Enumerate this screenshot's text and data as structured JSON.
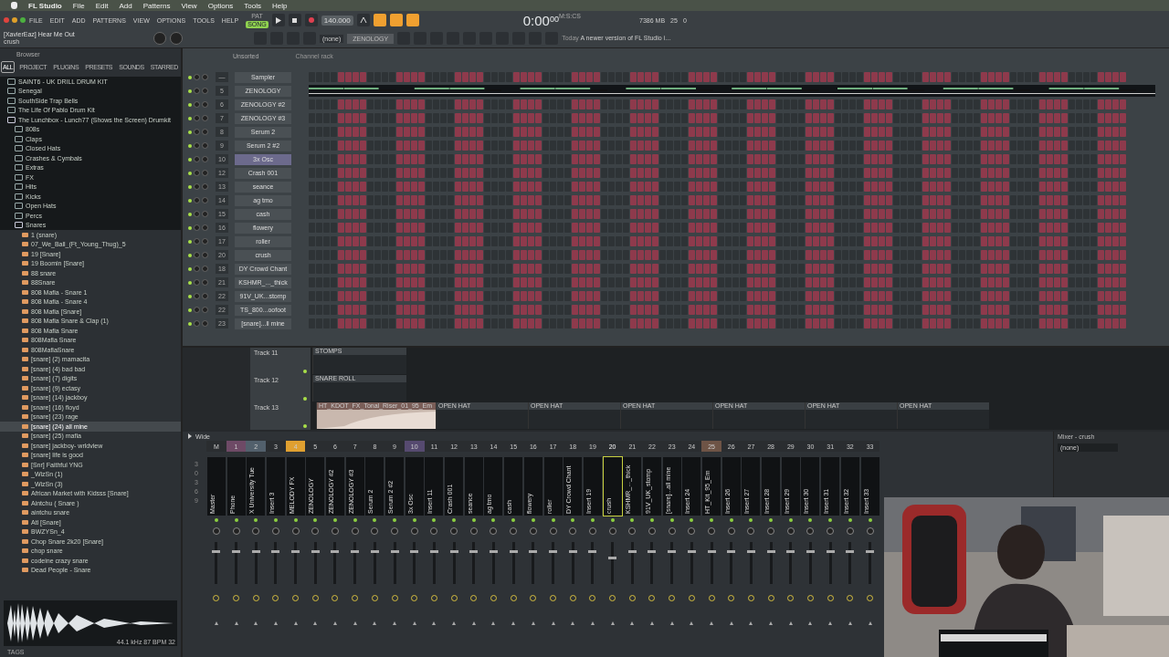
{
  "mac_menu": {
    "app": "FL Studio",
    "items": [
      "File",
      "Edit",
      "Add",
      "Patterns",
      "View",
      "Options",
      "Tools",
      "Help"
    ]
  },
  "toolbar": {
    "menu": [
      "FILE",
      "EDIT",
      "ADD",
      "PATTERNS",
      "VIEW",
      "OPTIONS",
      "TOOLS",
      "HELP"
    ],
    "modes": [
      {
        "label": "PAT",
        "selected": false
      },
      {
        "label": "SONG",
        "selected": true
      }
    ],
    "tempo": "140.000",
    "time": "0:00",
    "time_small": "00",
    "time_unit": "M:S:CS",
    "cpu": "25",
    "memory": "7386 MB",
    "polyphony": "0",
    "hint_title": "[XavierEaz] Hear Me Out",
    "hint_sub": "crush",
    "pattern": "(none)",
    "plugin": "ZENOLOGY",
    "news_date": "Today",
    "news": "A newer version of FL Studio i…"
  },
  "browser": {
    "title": "Browser",
    "tabs": [
      {
        "label": "ALL",
        "selected": true
      },
      {
        "label": "PROJECT",
        "selected": false
      },
      {
        "label": "PLUGINS",
        "selected": false
      },
      {
        "label": "PRESETS",
        "selected": false
      },
      {
        "label": "SOUNDS",
        "selected": false
      },
      {
        "label": "STARRED",
        "selected": false
      }
    ],
    "tree": [
      {
        "name": "SAINT6 - UK DRILL DRUM KIT",
        "kind": "folder",
        "expanded": false,
        "selected": false
      },
      {
        "name": "Senegal",
        "kind": "folder",
        "expanded": false,
        "selected": false
      },
      {
        "name": "SouthSide Trap Bells",
        "kind": "folder",
        "expanded": false,
        "selected": false
      },
      {
        "name": "The Life Of Pablo Drum Kit",
        "kind": "folder",
        "expanded": false,
        "selected": false
      },
      {
        "name": "The Lunchbox - Lunch77 (Shows the Screen) Drumkit",
        "kind": "folder",
        "expanded": true,
        "selected": false,
        "children": [
          {
            "name": "808s",
            "kind": "folder",
            "expanded": false,
            "selected": false
          },
          {
            "name": "Claps",
            "kind": "folder",
            "expanded": false,
            "selected": false
          },
          {
            "name": "Closed Hats",
            "kind": "folder",
            "expanded": false,
            "selected": false
          },
          {
            "name": "Crashes & Cymbals",
            "kind": "folder",
            "expanded": false,
            "selected": false
          },
          {
            "name": "Extras",
            "kind": "folder",
            "expanded": false,
            "selected": false
          },
          {
            "name": "FX",
            "kind": "folder",
            "expanded": false,
            "selected": false
          },
          {
            "name": "Hits",
            "kind": "folder",
            "expanded": false,
            "selected": false
          },
          {
            "name": "Kicks",
            "kind": "folder",
            "expanded": false,
            "selected": false
          },
          {
            "name": "Open Hats",
            "kind": "folder",
            "expanded": false,
            "selected": false
          },
          {
            "name": "Percs",
            "kind": "folder",
            "expanded": false,
            "selected": false
          },
          {
            "name": "Snares",
            "kind": "folder",
            "expanded": true,
            "selected": false,
            "children": [
              {
                "name": "1 (snare)",
                "kind": "file",
                "selected": false
              },
              {
                "name": "07_We_Ball_(Ft_Young_Thug)_5",
                "kind": "file",
                "selected": false
              },
              {
                "name": "19 [Snare]",
                "kind": "file",
                "selected": false
              },
              {
                "name": "19 Boomin [Snare]",
                "kind": "file",
                "selected": false
              },
              {
                "name": "88 snare",
                "kind": "file",
                "selected": false
              },
              {
                "name": "88Snare",
                "kind": "file",
                "selected": false
              },
              {
                "name": "808 Mafia - Snare 1",
                "kind": "file",
                "selected": false
              },
              {
                "name": "808 Mafia - Snare 4",
                "kind": "file",
                "selected": false
              },
              {
                "name": "808 Mafia [Snare]",
                "kind": "file",
                "selected": false
              },
              {
                "name": "808 Mafia Snare & Clap (1)",
                "kind": "file",
                "selected": false
              },
              {
                "name": "808 Mafia Snare",
                "kind": "file",
                "selected": false
              },
              {
                "name": "808Mafia Snare",
                "kind": "file",
                "selected": false
              },
              {
                "name": "808MafiaSnare",
                "kind": "file",
                "selected": false
              },
              {
                "name": "[snare] (2) mamacita",
                "kind": "file",
                "selected": false
              },
              {
                "name": "[snare] (4) bad bad",
                "kind": "file",
                "selected": false
              },
              {
                "name": "[snare] (7) digits",
                "kind": "file",
                "selected": false
              },
              {
                "name": "[snare] (9) ectasy",
                "kind": "file",
                "selected": false
              },
              {
                "name": "[snare] (14)  jackboy",
                "kind": "file",
                "selected": false
              },
              {
                "name": "[snare] (16) floyd",
                "kind": "file",
                "selected": false
              },
              {
                "name": "[snare] (23) rage",
                "kind": "file",
                "selected": false
              },
              {
                "name": "[snare] (24) all mine",
                "kind": "file",
                "selected": true
              },
              {
                "name": "[snare] (25) mafia",
                "kind": "file",
                "selected": false
              },
              {
                "name": "[snare] jackboy- wrldview",
                "kind": "file",
                "selected": false
              },
              {
                "name": "[snare] life is good",
                "kind": "file",
                "selected": false
              },
              {
                "name": "[Snr] Faithful YNG",
                "kind": "file",
                "selected": false
              },
              {
                "name": "_WizSn (1)",
                "kind": "file",
                "selected": false
              },
              {
                "name": "_WizSn (3)",
                "kind": "file",
                "selected": false
              },
              {
                "name": "African Market with Kidsss  [Snare]",
                "kind": "file",
                "selected": false
              },
              {
                "name": "Aintchu ( Snare )",
                "kind": "file",
                "selected": false
              },
              {
                "name": "aintchu snare",
                "kind": "file",
                "selected": false
              },
              {
                "name": "Atl [Snare]",
                "kind": "file",
                "selected": false
              },
              {
                "name": "BWZYSn_4",
                "kind": "file",
                "selected": false
              },
              {
                "name": "Chop Snare 2k20 [Snare]",
                "kind": "file",
                "selected": false
              },
              {
                "name": "chop snare",
                "kind": "file",
                "selected": false
              },
              {
                "name": "codeine crazy snare",
                "kind": "file",
                "selected": false
              },
              {
                "name": "Dead People - Snare",
                "kind": "file",
                "selected": false
              }
            ]
          }
        ]
      }
    ],
    "sample_info": "44.1 kHz 87 BPM 32",
    "tags": "TAGS"
  },
  "channel_rack": {
    "group": "Unsorted",
    "title": "Channel rack",
    "channels": [
      {
        "number": "—",
        "name": "Sampler",
        "kind": "steps",
        "selected": false
      },
      {
        "number": "5",
        "name": "ZENOLOGY",
        "kind": "preview",
        "selected": false
      },
      {
        "number": "6",
        "name": "ZENOLOGY #2",
        "kind": "steps",
        "selected": false
      },
      {
        "number": "7",
        "name": "ZENOLOGY #3",
        "kind": "steps",
        "selected": false
      },
      {
        "number": "8",
        "name": "Serum 2",
        "kind": "steps",
        "selected": false
      },
      {
        "number": "9",
        "name": "Serum 2 #2",
        "kind": "steps",
        "selected": false
      },
      {
        "number": "10",
        "name": "3x Osc",
        "kind": "steps",
        "selected": true
      },
      {
        "number": "12",
        "name": "Crash 001",
        "kind": "steps",
        "selected": false
      },
      {
        "number": "13",
        "name": "seance",
        "kind": "steps",
        "selected": false
      },
      {
        "number": "14",
        "name": "ag tmo",
        "kind": "steps",
        "selected": false
      },
      {
        "number": "15",
        "name": "cash",
        "kind": "steps",
        "selected": false
      },
      {
        "number": "16",
        "name": "flowery",
        "kind": "steps",
        "selected": false
      },
      {
        "number": "17",
        "name": "roller",
        "kind": "steps",
        "selected": false
      },
      {
        "number": "20",
        "name": "crush",
        "kind": "steps",
        "selected": false
      },
      {
        "number": "18",
        "name": "DY Crowd Chant",
        "kind": "steps",
        "selected": false
      },
      {
        "number": "21",
        "name": "KSHMR_..._thick",
        "kind": "steps",
        "selected": false
      },
      {
        "number": "22",
        "name": "91V_UK...stomp",
        "kind": "steps",
        "selected": false
      },
      {
        "number": "22",
        "name": "TS_800...oofoot",
        "kind": "steps",
        "selected": false
      },
      {
        "number": "23",
        "name": "[snare]...ll mine",
        "kind": "steps",
        "selected": false
      }
    ]
  },
  "playlist": {
    "tracks": [
      {
        "name": "Track 11",
        "clips": [
          {
            "name": "STOMPS",
            "kind": "pattern"
          }
        ]
      },
      {
        "name": "Track 12",
        "clips": [
          {
            "name": "SNARE ROLL",
            "kind": "pattern"
          }
        ]
      },
      {
        "name": "Track 13",
        "clips": [
          {
            "name": "HT_KDOT_FX_Tonal_Riser_01_95_Em",
            "kind": "audio"
          },
          {
            "name": "OPEN HAT",
            "kind": "pattern"
          },
          {
            "name": "OPEN HAT",
            "kind": "pattern"
          },
          {
            "name": "OPEN HAT",
            "kind": "pattern"
          },
          {
            "name": "OPEN HAT",
            "kind": "pattern"
          },
          {
            "name": "OPEN HAT",
            "kind": "pattern"
          },
          {
            "name": "OPEN HAT",
            "kind": "pattern"
          }
        ]
      }
    ]
  },
  "mixer": {
    "title": "Wide",
    "scale": [
      "3",
      "0",
      "3",
      "6",
      "9"
    ],
    "panel_title": "Mixer - crush",
    "slot": "(none)",
    "inserts": [
      {
        "number": "M",
        "name": "Master",
        "color": "#2a2d30",
        "selected": false,
        "level": 0.8
      },
      {
        "number": "1",
        "name": "Phone",
        "color": "#6e4a66",
        "selected": false,
        "level": 0.8
      },
      {
        "number": "2",
        "name": "X University Tue",
        "color": "#52606c",
        "selected": false,
        "level": 0.8
      },
      {
        "number": "3",
        "name": "Insert 3",
        "color": "#2a2d30",
        "selected": false,
        "level": 0.8
      },
      {
        "number": "4",
        "name": "MELODY FX",
        "color": "#e0a030",
        "selected": false,
        "level": 0.8
      },
      {
        "number": "5",
        "name": "ZENOLOGY",
        "color": "#2a2d30",
        "selected": false,
        "level": 0.8
      },
      {
        "number": "6",
        "name": "ZENOLOGY #2",
        "color": "#2a2d30",
        "selected": false,
        "level": 0.8
      },
      {
        "number": "7",
        "name": "ZENOLOGY #3",
        "color": "#2a2d30",
        "selected": false,
        "level": 0.8
      },
      {
        "number": "8",
        "name": "Serum 2",
        "color": "#2a2d30",
        "selected": false,
        "level": 0.8
      },
      {
        "number": "9",
        "name": "Serum 2 #2",
        "color": "#2a2d30",
        "selected": false,
        "level": 0.8
      },
      {
        "number": "10",
        "name": "3x Osc",
        "color": "#564a70",
        "selected": false,
        "level": 0.8
      },
      {
        "number": "11",
        "name": "Insert 11",
        "color": "#2a2d30",
        "selected": false,
        "level": 0.8
      },
      {
        "number": "12",
        "name": "Crash 001",
        "color": "#2a2d30",
        "selected": false,
        "level": 0.8
      },
      {
        "number": "13",
        "name": "seance",
        "color": "#2a2d30",
        "selected": false,
        "level": 0.8
      },
      {
        "number": "14",
        "name": "ag tmo",
        "color": "#2a2d30",
        "selected": false,
        "level": 0.8
      },
      {
        "number": "15",
        "name": "cash",
        "color": "#2a2d30",
        "selected": false,
        "level": 0.8
      },
      {
        "number": "16",
        "name": "flowery",
        "color": "#2a2d30",
        "selected": false,
        "level": 0.8
      },
      {
        "number": "17",
        "name": "roller",
        "color": "#2a2d30",
        "selected": false,
        "level": 0.8
      },
      {
        "number": "18",
        "name": "DY Crowd Chant",
        "color": "#2a2d30",
        "selected": false,
        "level": 0.8
      },
      {
        "number": "19",
        "name": "Insert 19",
        "color": "#2a2d30",
        "selected": false,
        "level": 0.8
      },
      {
        "number": "20",
        "name": "crush",
        "color": "#2a2d30",
        "selected": true,
        "level": 0.62
      },
      {
        "number": "21",
        "name": "KSHMR_..._thick",
        "color": "#2a2d30",
        "selected": false,
        "level": 0.8
      },
      {
        "number": "22",
        "name": "91V_UK_stomp",
        "color": "#2a2d30",
        "selected": false,
        "level": 0.8
      },
      {
        "number": "23",
        "name": "[snare]...all mine",
        "color": "#2a2d30",
        "selected": false,
        "level": 0.8
      },
      {
        "number": "24",
        "name": "Insert 24",
        "color": "#2a2d30",
        "selected": false,
        "level": 0.8
      },
      {
        "number": "25",
        "name": "HT_Kit_95_Em",
        "color": "#6e5446",
        "selected": false,
        "level": 0.8
      },
      {
        "number": "26",
        "name": "Insert 26",
        "color": "#2a2d30",
        "selected": false,
        "level": 0.8
      },
      {
        "number": "27",
        "name": "Insert 27",
        "color": "#2a2d30",
        "selected": false,
        "level": 0.8
      },
      {
        "number": "28",
        "name": "Insert 28",
        "color": "#2a2d30",
        "selected": false,
        "level": 0.8
      },
      {
        "number": "29",
        "name": "Insert 29",
        "color": "#2a2d30",
        "selected": false,
        "level": 0.8
      },
      {
        "number": "30",
        "name": "Insert 30",
        "color": "#2a2d30",
        "selected": false,
        "level": 0.8
      },
      {
        "number": "31",
        "name": "Insert 31",
        "color": "#2a2d30",
        "selected": false,
        "level": 0.8
      },
      {
        "number": "32",
        "name": "Insert 32",
        "color": "#2a2d30",
        "selected": false,
        "level": 0.8
      },
      {
        "number": "33",
        "name": "Insert 33",
        "color": "#2a2d30",
        "selected": false,
        "level": 0.8
      }
    ]
  }
}
